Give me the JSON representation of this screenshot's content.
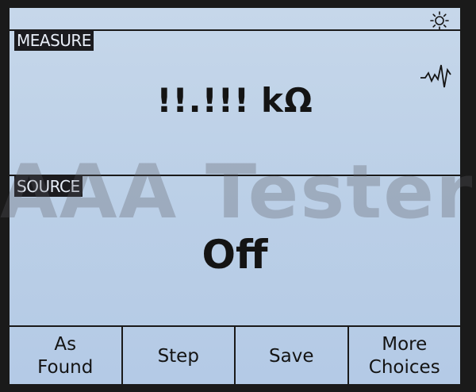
{
  "measure": {
    "label": "MEASURE",
    "reading": "!!.!!!",
    "unit": "kΩ"
  },
  "source": {
    "label": "SOURCE",
    "value": "Off"
  },
  "watermark": "AAA Testers",
  "icons": {
    "brightness": "sun-icon",
    "signal": "waveform-icon"
  },
  "softkeys": [
    {
      "label": "As\nFound"
    },
    {
      "label": "Step"
    },
    {
      "label": "Save"
    },
    {
      "label": "More\nChoices"
    }
  ],
  "colors": {
    "screen": "#bcd0e7",
    "ink": "#141414",
    "tag_bg": "#1b1b1f"
  }
}
